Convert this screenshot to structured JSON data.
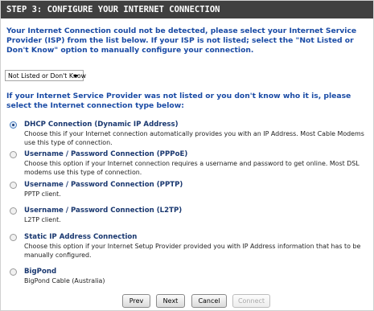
{
  "header": {
    "title": "STEP 3: CONFIGURE YOUR INTERNET CONNECTION"
  },
  "intro_text": "Your Internet Connection could not be detected, please select your Internet Service Provider (ISP) from the list below. If your ISP is not listed; select the \"Not Listed or Don't Know\" option to manually configure your connection.",
  "isp_select": {
    "value": "Not Listed or Don't Know"
  },
  "prompt_text": "If your Internet Service Provider was not listed or you don't know who it is, please select the Internet connection type below:",
  "options": [
    {
      "title": "DHCP Connection (Dynamic IP Address)",
      "desc": "Choose this if your Internet connection automatically provides you with an IP Address. Most Cable Modems use this type of connection.",
      "checked": true
    },
    {
      "title": "Username / Password Connection (PPPoE)",
      "desc": "Choose this option if your Internet connection requires a username and password to get online. Most DSL modems use this type of connection.",
      "checked": false
    },
    {
      "title": "Username / Password Connection (PPTP)",
      "desc": "PPTP client.",
      "checked": false
    },
    {
      "title": "Username / Password Connection (L2TP)",
      "desc": "L2TP client.",
      "checked": false
    },
    {
      "title": "Static IP Address Connection",
      "desc": "Choose this option if your Internet Setup Provider provided you with IP Address information that has to be manually configured.",
      "checked": false
    },
    {
      "title": "BigPond",
      "desc": "BigPond Cable (Australia)",
      "checked": false
    }
  ],
  "buttons": {
    "prev": "Prev",
    "next": "Next",
    "cancel": "Cancel",
    "connect": "Connect"
  }
}
